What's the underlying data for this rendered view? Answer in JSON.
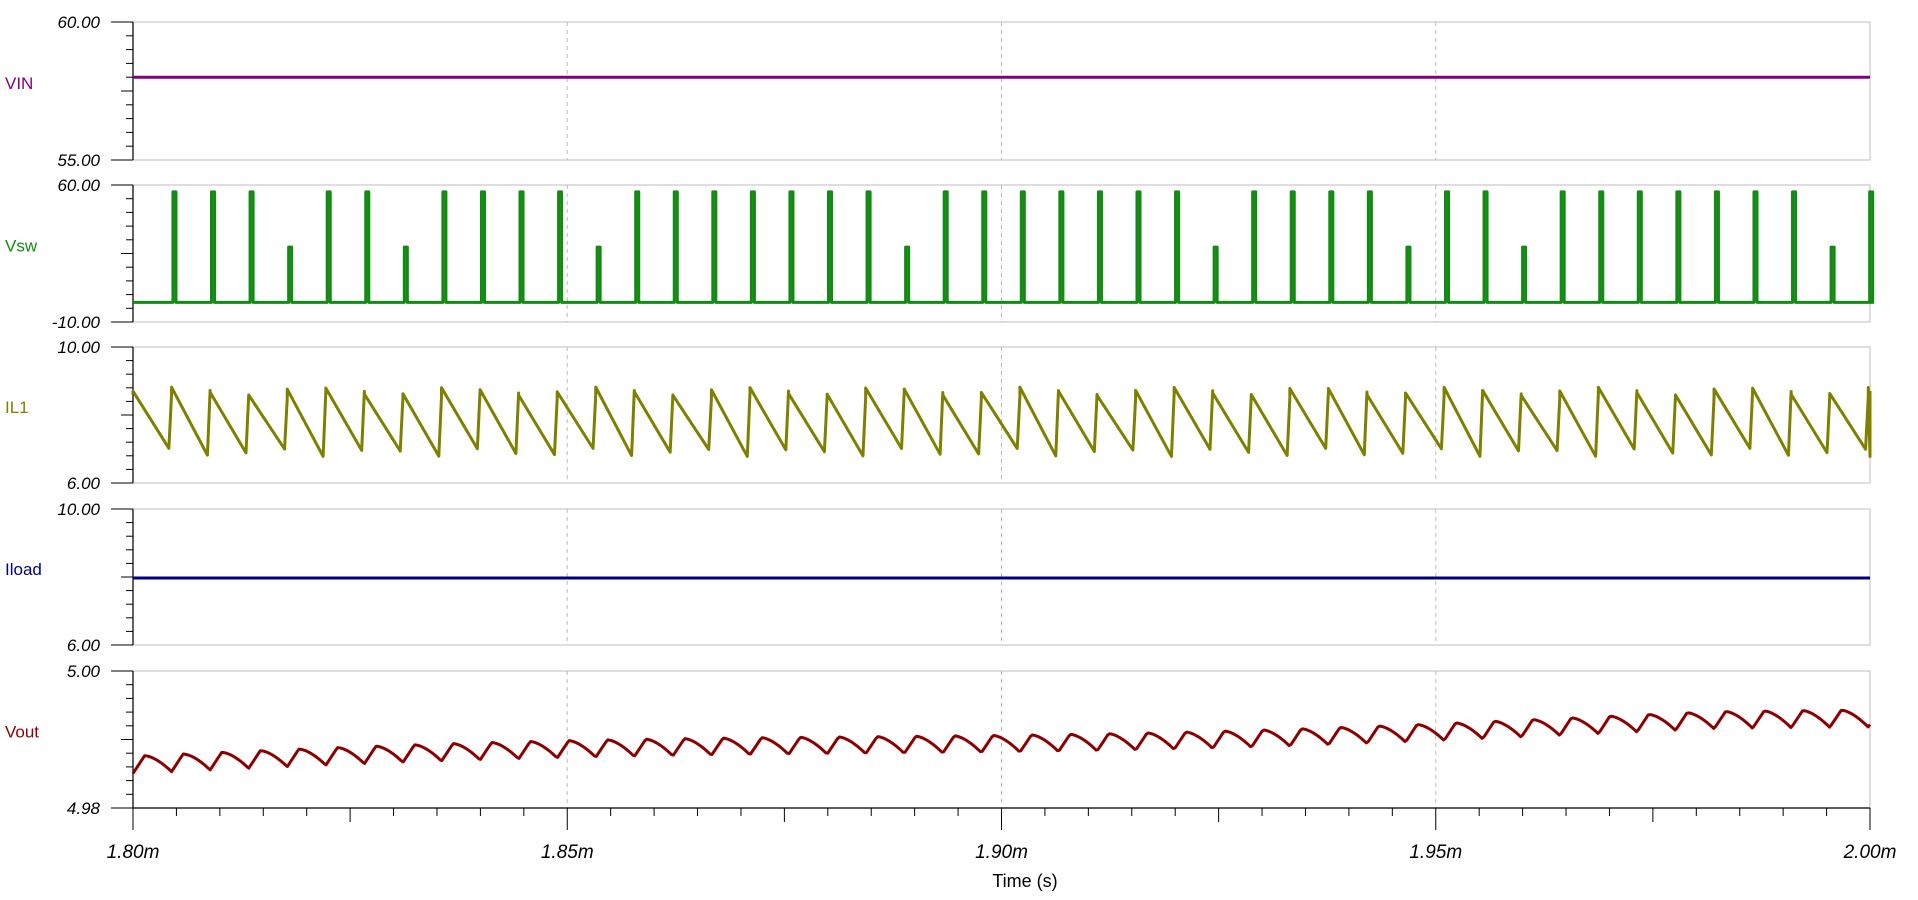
{
  "chart_data": {
    "type": "line",
    "description": "Stacked transient waveforms",
    "x_axis": {
      "label": "Time (s)",
      "range_s": [
        0.0018,
        0.002
      ],
      "ticks": [
        {
          "value": 0.0018,
          "label": "1.80m"
        },
        {
          "value": 0.00185,
          "label": "1.85m"
        },
        {
          "value": 0.0019,
          "label": "1.90m"
        },
        {
          "value": 0.00195,
          "label": "1.95m"
        },
        {
          "value": 0.002,
          "label": "2.00m"
        }
      ]
    },
    "panels": [
      {
        "name": "VIN",
        "color": "#800080",
        "ylim": [
          55.0,
          60.0
        ],
        "tick_labels": [
          "60.00",
          "55.00"
        ],
        "kind": "dc",
        "level": 58.0
      },
      {
        "name": "Vsw",
        "color": "#138a13",
        "ylim": [
          -10.0,
          60.0
        ],
        "tick_labels": [
          "60.00",
          "-10.00"
        ],
        "kind": "switching",
        "low": 0.0,
        "high": 56.5,
        "period_s": 4.44e-06,
        "first_edge_s": 1.804e-06,
        "pulse_width_s": 3.5e-07
      },
      {
        "name": "IL1",
        "color": "#808000",
        "ylim": [
          6.0,
          10.0
        ],
        "tick_labels": [
          "10.00",
          "6.00"
        ],
        "kind": "sawtooth",
        "valley": 6.9,
        "peak": 8.7,
        "period_s": 4.44e-06
      },
      {
        "name": "Iload",
        "color": "#000080",
        "ylim": [
          6.0,
          10.0
        ],
        "tick_labels": [
          "10.00",
          "6.00"
        ],
        "kind": "dc",
        "level": 7.97
      },
      {
        "name": "Vout",
        "color": "#8b0000",
        "ylim": [
          4.98,
          5.0
        ],
        "tick_labels": [
          "5.00",
          "4.98"
        ],
        "kind": "ripple",
        "baseline_start": 4.9863,
        "baseline_end": 4.9925,
        "ripple_pp": 0.0025,
        "period_s": 4.44e-06
      }
    ],
    "grid": "vertical dashed at major x ticks",
    "legend": "left"
  }
}
